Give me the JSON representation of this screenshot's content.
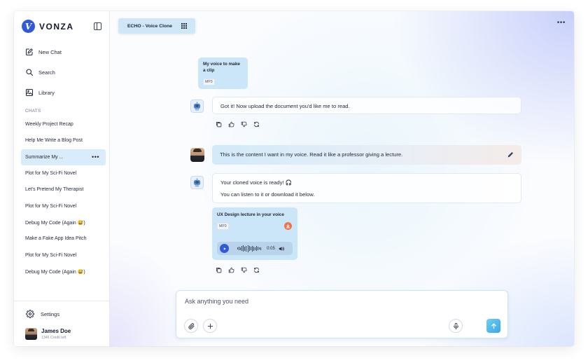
{
  "brand": {
    "name": "VONZA",
    "logo_letter": "V"
  },
  "sidebar": {
    "nav": [
      {
        "label": "New Chat",
        "icon": "edit-icon"
      },
      {
        "label": "Search",
        "icon": "search-icon"
      },
      {
        "label": "Library",
        "icon": "library-icon"
      }
    ],
    "chats_label": "CHATS",
    "chats": [
      "Weekly Project Recap",
      "Help Me Write a Blog Post",
      "Summarize My ...",
      "Plot for My Sci-Fi Novel",
      "Let's Pretend My Therapist",
      "Plot for My Sci-Fi Novel",
      "Debug My Code (Again 😅)",
      "Make a Fake App Idea Pitch",
      "Plot for My Sci-Fi Novel",
      "Debug My Code (Again 😅)"
    ],
    "active_chat_index": 2,
    "more_label": "•••",
    "settings_label": "Settings",
    "user": {
      "name": "James Doe",
      "credit": "1346 Credit left"
    }
  },
  "header": {
    "tab_label": "ECHO - Voice Clone",
    "more_label": "•••"
  },
  "messages": {
    "user_file": {
      "title": "My voice to make a clip",
      "tag": "MP3"
    },
    "bot_reply_1": "Got it! Now upload the document you'd like me to read.",
    "user_text": "This is the content I want in my voice. Read it like a professor giving a lecture.",
    "bot_reply_2_line1": "Your cloned voice is ready! 🎧",
    "bot_reply_2_line2": "You can listen to it or download it below.",
    "audio": {
      "title": "UX Design lecture in your voice",
      "tag": "MP3",
      "time": "0:05"
    }
  },
  "composer": {
    "placeholder": "Ask anything you need"
  },
  "colors": {
    "accent": "#2f5bd8",
    "active_chat": "#d9ecfb",
    "bubble": "#cbe6f8",
    "download": "#ee7447",
    "send": "#3aa6e6"
  }
}
